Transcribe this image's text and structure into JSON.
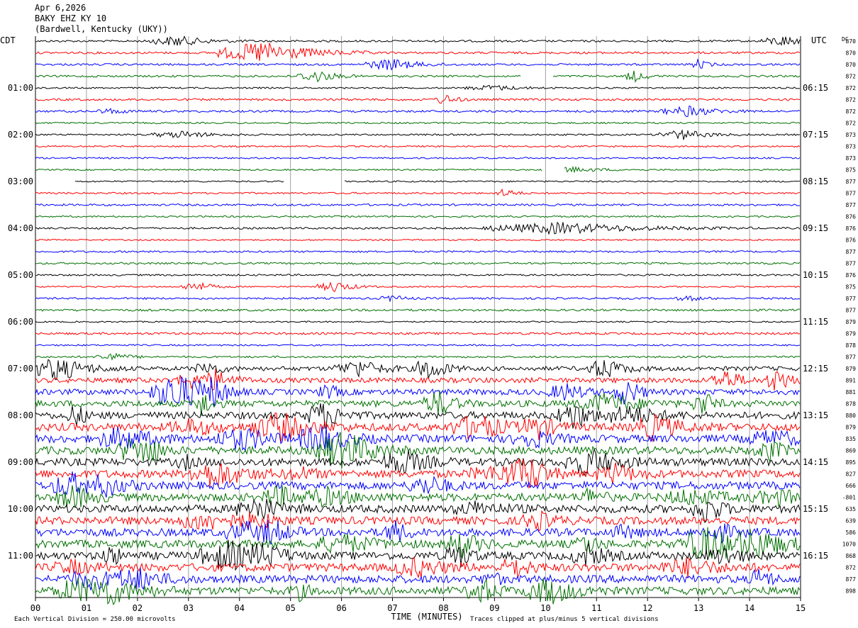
{
  "header": {
    "date": "Apr 6,2026",
    "station": "BAKY EHZ KY 10",
    "location": "(Bardwell, Kentucky (UKY))"
  },
  "chart_data": {
    "type": "line",
    "left_axis_label": "CDT",
    "right_axis_label": "UTC",
    "dc_label": "DC",
    "xlabel": "TIME (MINUTES)",
    "xlim": [
      0,
      15
    ],
    "x_ticks": [
      "00",
      "01",
      "02",
      "03",
      "04",
      "05",
      "06",
      "07",
      "08",
      "09",
      "10",
      "11",
      "12",
      "13",
      "14",
      "15"
    ],
    "left_times": [
      "01:00",
      "02:00",
      "03:00",
      "04:00",
      "05:00",
      "06:00",
      "07:00",
      "08:00",
      "09:00",
      "10:00",
      "11:00"
    ],
    "right_times": [
      "06:15",
      "07:15",
      "08:15",
      "09:15",
      "10:15",
      "11:15",
      "12:15",
      "13:15",
      "14:15",
      "15:15",
      "16:15"
    ],
    "trace_colors": [
      "#000000",
      "#ff0000",
      "#0000ff",
      "#007000"
    ],
    "trace_count": 48,
    "dc_values": [
      "870",
      "870",
      "870",
      "872",
      "872",
      "872",
      "872",
      "872",
      "873",
      "873",
      "873",
      "875",
      "877",
      "877",
      "877",
      "876",
      "876",
      "876",
      "877",
      "877",
      "876",
      "875",
      "877",
      "877",
      "879",
      "879",
      "878",
      "877",
      "879",
      "891",
      "881",
      "878",
      "880",
      "879",
      "835",
      "869",
      "895",
      "827",
      "666",
      "-801",
      "635",
      "639",
      "586",
      "1070",
      "868",
      "872",
      "877",
      "898"
    ],
    "footer_left": "Each Vertical Division =  250.00 microvolts",
    "footer_right": "Traces clipped at plus/minus 5 vertical divisions"
  }
}
